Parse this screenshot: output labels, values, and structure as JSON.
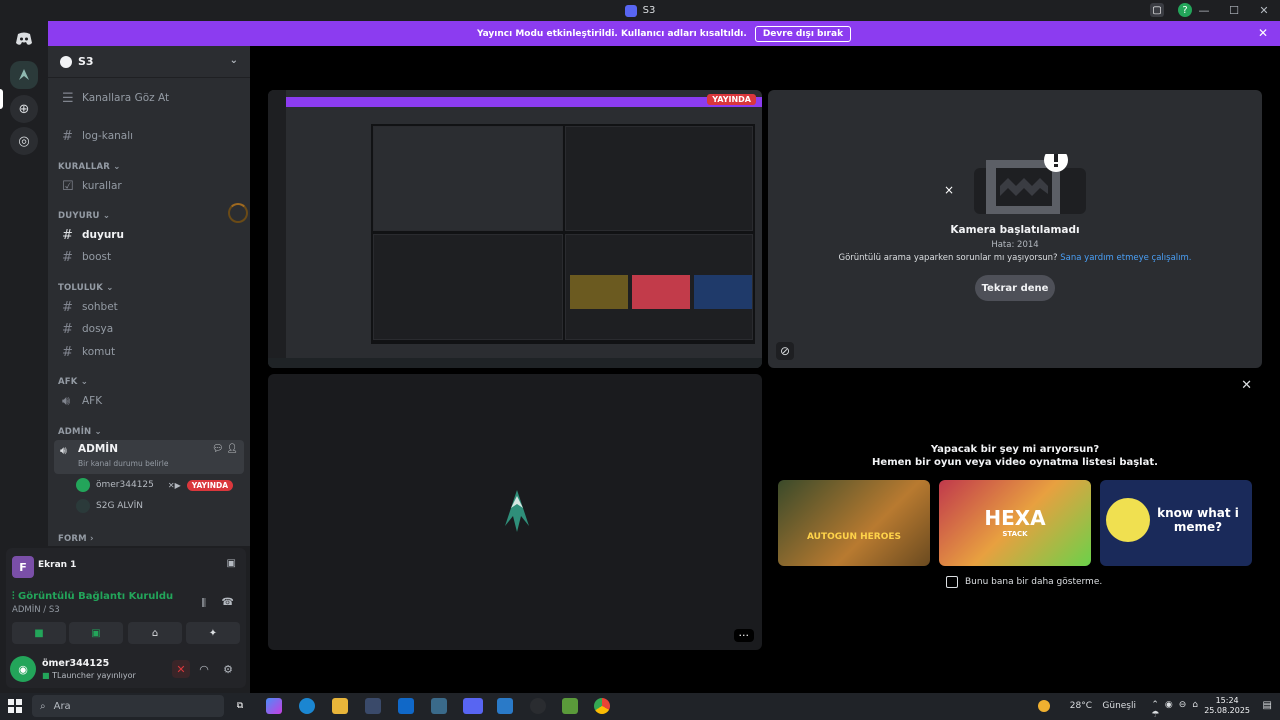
{
  "window": {
    "title": "S3"
  },
  "banner": {
    "text": "Yayıncı Modu etkinleştirildi. Kullanıcı adları kısaltıldı.",
    "button": "Devre dışı bırak"
  },
  "server": {
    "name": "S3"
  },
  "channels": {
    "browse": "Kanallara Göz At",
    "log": "log-kanalı",
    "cat_kurallar": "KURALLAR",
    "kurallar": "kurallar",
    "cat_duyuru": "DUYURU",
    "duyuru": "duyuru",
    "boost": "boost",
    "cat_toluluk": "TOLULUK",
    "sohbet": "sohbet",
    "dosya": "dosya",
    "komut": "komut",
    "cat_afk": "AFK",
    "afk": "AFK",
    "cat_admin": "ADMİN",
    "admin_voice": "ADMİN",
    "admin_status": "Bir kanal durumu belirle",
    "cat_form": "FORM"
  },
  "voice_users": [
    {
      "name": "ömer344125",
      "badge": "YAYINDA"
    },
    {
      "name": "S2G ALVİN"
    }
  ],
  "panel": {
    "screen_label": "Ekran 1",
    "screen_chip": "F",
    "connected": "Görüntülü Bağlantı Kuruldu",
    "connected_sub": "ADMİN / S3",
    "username": "ömer344125",
    "user_status": "TLauncher yayınlıyor"
  },
  "stream": {
    "live_badge": "YAYINDA"
  },
  "camera": {
    "title": "Kamera başlatılamadı",
    "error": "Hata: 2014",
    "help_text": "Görüntülü arama yaparken sorunlar mı yaşıyorsun?",
    "help_link": "Sana yardım etmeye çalışalım.",
    "retry": "Tekrar dene"
  },
  "activity": {
    "heading1": "Yapacak bir şey mi arıyorsun?",
    "heading2": "Hemen bir oyun veya video oynatma listesi başlat.",
    "games": [
      "AUTOGUN HEROES",
      "HEXA",
      "STACK",
      "know what i meme?"
    ],
    "dont_show": "Bunu bana bir daha gösterme."
  },
  "taskbar": {
    "search": "Ara",
    "weather_temp": "28°C",
    "weather_desc": "Güneşli",
    "time": "15:24",
    "date": "25.08.2025"
  },
  "colors": {
    "brand": "#5865f2",
    "banner": "#8c3cf0",
    "live": "#da373c",
    "online": "#23a55a"
  }
}
